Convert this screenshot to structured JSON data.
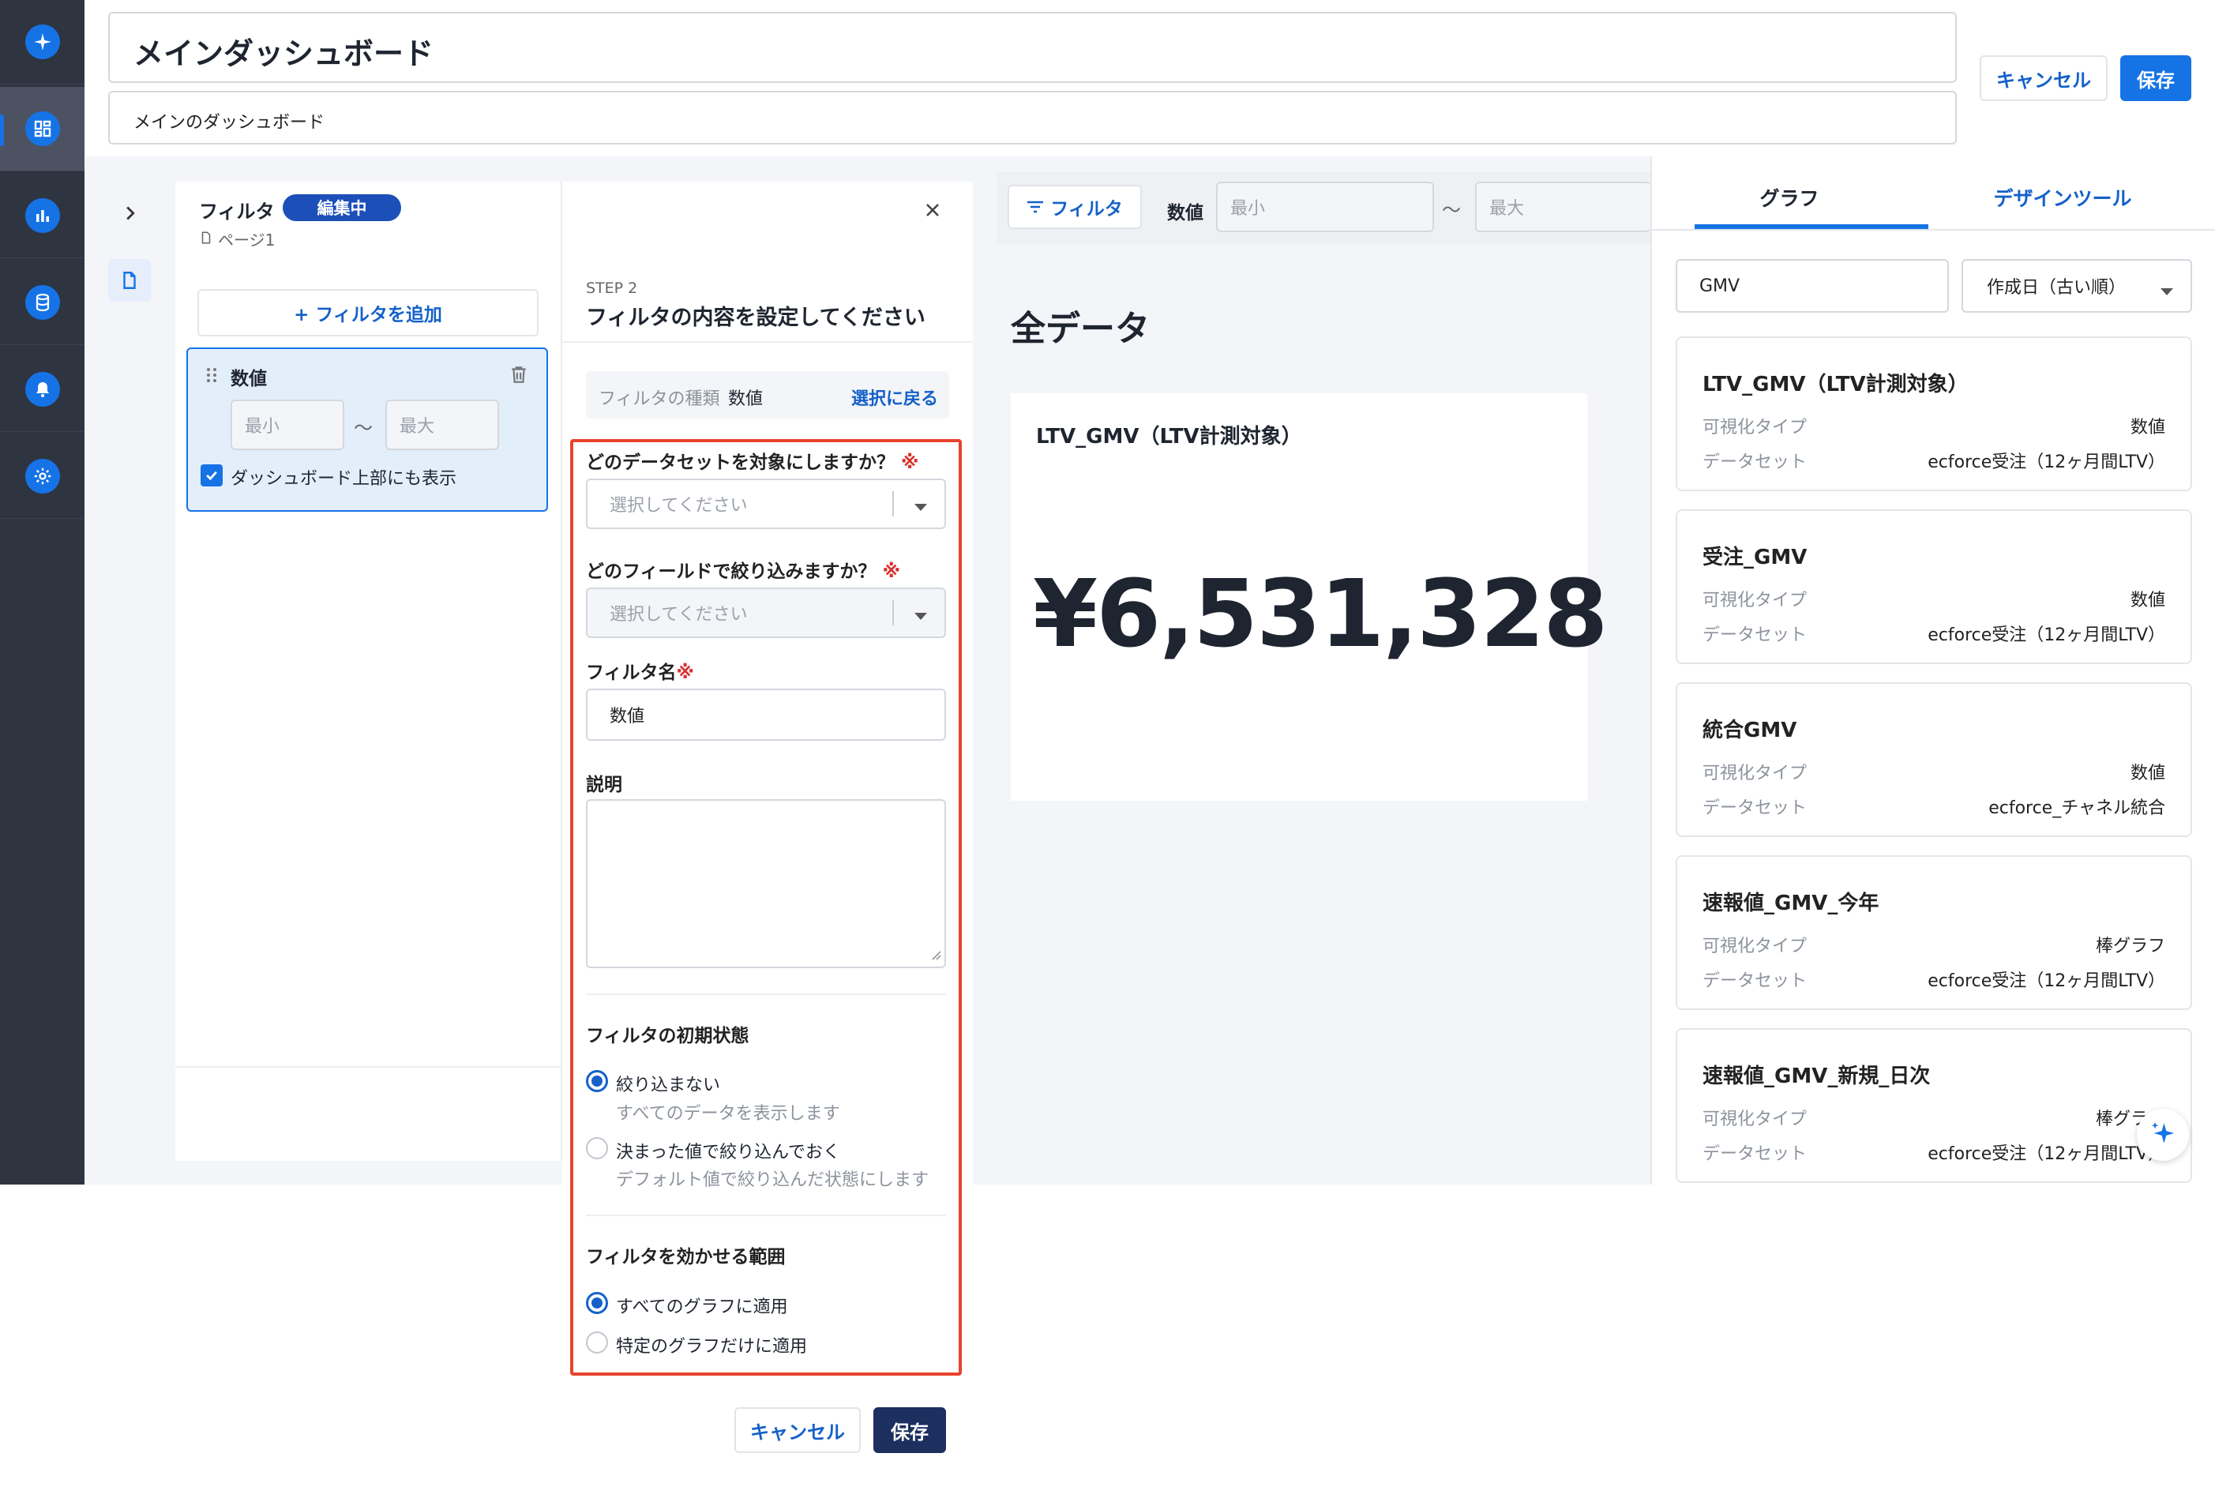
{
  "header": {
    "title": "メインダッシュボード",
    "subtitle": "メインのダッシュボード",
    "cancel_label": "キャンセル",
    "save_label": "保存"
  },
  "filter_panel": {
    "title": "フィルタ",
    "badge": "編集中",
    "page": "ページ1",
    "add_filter_label": "+ フィルタを追加",
    "item": {
      "name": "数値",
      "min_placeholder": "最小",
      "max_placeholder": "最大",
      "tilde": "〜",
      "show_on_top_label": "ダッシュボード上部にも表示"
    }
  },
  "step_form": {
    "step": "STEP 2",
    "heading": "フィルタの内容を設定してください",
    "type_label": "フィルタの種類",
    "type_value": "数値",
    "back_link": "選択に戻る",
    "dataset_label": "どのデータセットを対象にしますか？",
    "dataset_placeholder": "選択してください",
    "field_label": "どのフィールドで絞り込みますか？",
    "field_placeholder": "選択してください",
    "required_mark": "※",
    "name_label": "フィルタ名",
    "name_value": "数値",
    "desc_label": "説明",
    "initial_state_label": "フィルタの初期状態",
    "initial_options": [
      {
        "label": "絞り込まない",
        "desc": "すべてのデータを表示します"
      },
      {
        "label": "決まった値で絞り込んでおく",
        "desc": "デフォルト値で絞り込んだ状態にします"
      }
    ],
    "scope_label": "フィルタを効かせる範囲",
    "scope_options": [
      "すべてのグラフに適用",
      "特定のグラフだけに適用"
    ],
    "cancel_label": "キャンセル",
    "save_label": "保存"
  },
  "filter_bar": {
    "filter_button": "フィルタ",
    "field_label": "数値",
    "min_placeholder": "最小",
    "max_placeholder": "最大",
    "tilde": "〜"
  },
  "canvas": {
    "section_title": "全データ",
    "card_title": "LTV_GMV（LTV計測対象）",
    "card_value": "¥6,531,328"
  },
  "right_panel": {
    "tabs": [
      "グラフ",
      "デザインツール"
    ],
    "search_value": "GMV",
    "sort_value": "作成日（古い順）",
    "type_key": "可視化タイプ",
    "dataset_key": "データセット",
    "cards": [
      {
        "title": "LTV_GMV（LTV計測対象）",
        "type": "数値",
        "dataset": "ecforce受注（12ヶ月間LTV）"
      },
      {
        "title": "受注_GMV",
        "type": "数値",
        "dataset": "ecforce受注（12ヶ月間LTV）"
      },
      {
        "title": "統合GMV",
        "type": "数値",
        "dataset": "ecforce_チャネル統合"
      },
      {
        "title": "速報値_GMV_今年",
        "type": "棒グラフ",
        "dataset": "ecforce受注（12ヶ月間LTV）"
      },
      {
        "title": "速報値_GMV_新規_日次",
        "type": "棒グラフ",
        "dataset": "ecforce受注（12ヶ月間LTV）"
      }
    ]
  },
  "colors": {
    "accent": "#1673e6",
    "sidebar": "#2f3441",
    "highlight": "#e8432f",
    "navy": "#1c2f5e"
  }
}
